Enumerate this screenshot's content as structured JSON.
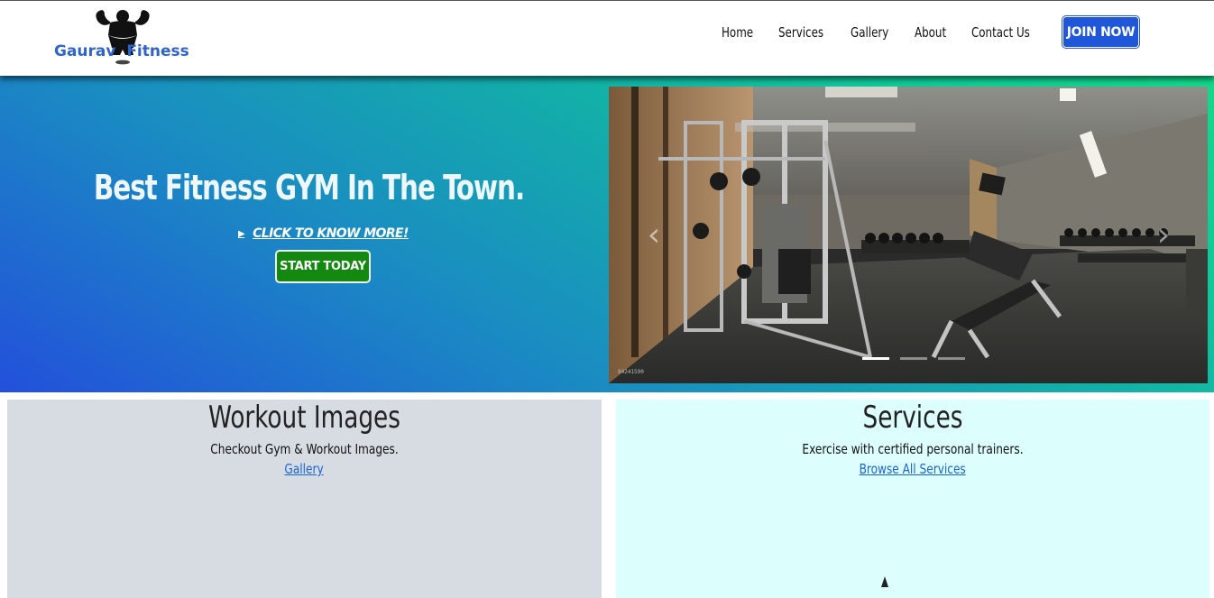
{
  "brand": {
    "name_left": "Gaurav",
    "name_right": "Fitness",
    "color": "#2f64c8"
  },
  "nav": {
    "items": [
      "Home",
      "Services",
      "Gallery",
      "About",
      "Contact Us"
    ],
    "join_label": "JOIN NOW",
    "join_color": "#1f57d8"
  },
  "hero": {
    "title": "Best Fitness GYM In The Town.",
    "link_label": "CLICK TO KNOW MORE!",
    "start_label": "START TODAY",
    "start_color": "#13890f"
  },
  "carousel": {
    "photo_code": "84241590",
    "active_slide": 1,
    "slide_count": 3
  },
  "cards": {
    "gallery": {
      "title": "Workout Images",
      "text": "Checkout Gym & Workout Images.",
      "link": "Gallery",
      "bg": "#d6dce2"
    },
    "services": {
      "title": "Services",
      "text": "Exercise with certified personal trainers.",
      "link": "Browse All Services",
      "bg": "#dcfffe"
    }
  }
}
